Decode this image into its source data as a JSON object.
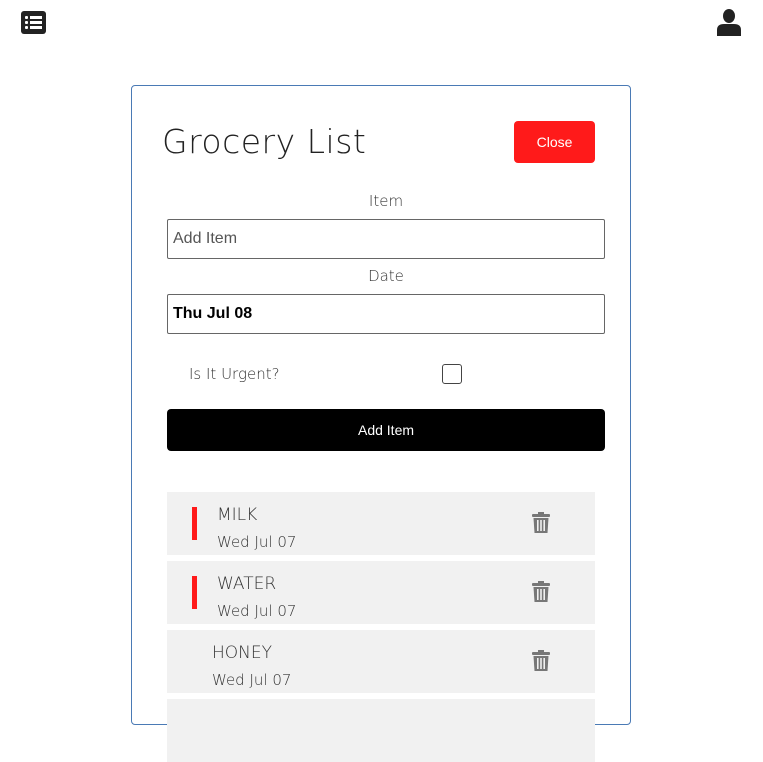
{
  "header": {
    "menu_icon": "list-icon",
    "user_icon": "user-icon"
  },
  "card": {
    "title": "Grocery List",
    "close_label": "Close",
    "item_label": "Item",
    "item_placeholder": "Add Item",
    "item_value": "",
    "date_label": "Date",
    "date_value": "Thu Jul 08",
    "urgent_label": "Is It Urgent?",
    "urgent_checked": false,
    "add_label": "Add Item",
    "accent": "#ff1a1a"
  },
  "items": [
    {
      "name": "MILK",
      "date": "Wed Jul 07",
      "urgent": true
    },
    {
      "name": "WATER",
      "date": "Wed Jul 07",
      "urgent": true
    },
    {
      "name": "HONEY",
      "date": "Wed Jul 07",
      "urgent": false
    }
  ]
}
